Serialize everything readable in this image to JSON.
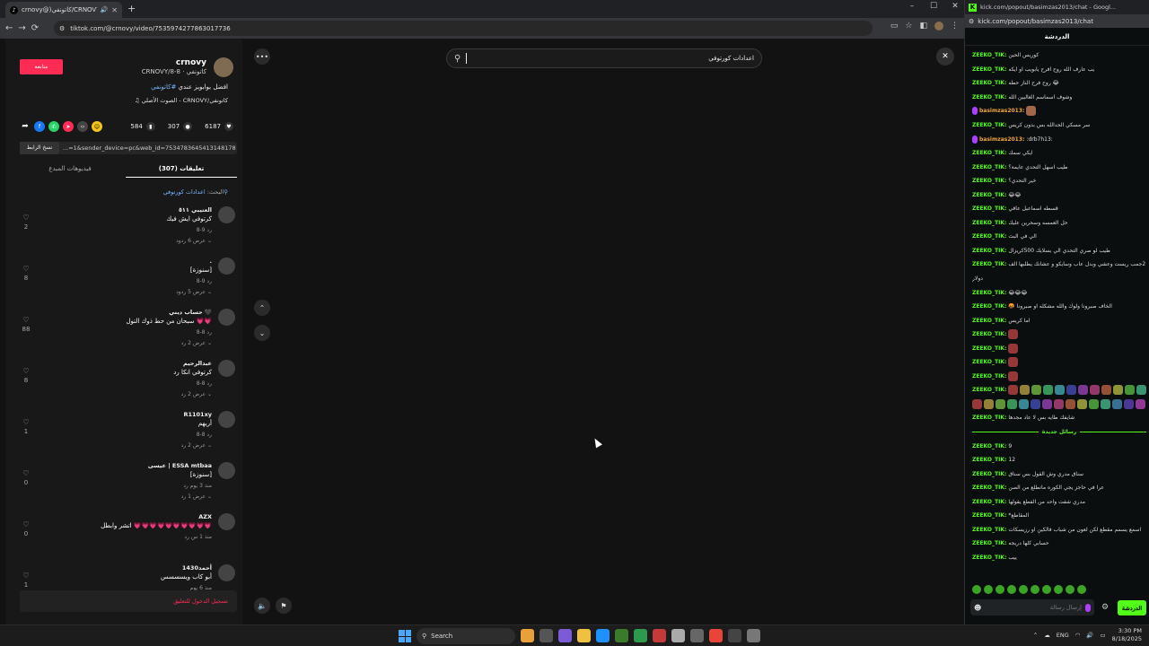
{
  "left_browser": {
    "tab_title": "crnovy@)كاتونفي/CRNOVY",
    "url": "tiktok.com/@crnovy/video/7535974277863017736",
    "new_tab": "+",
    "icons": {
      "back": "arrow-left-icon",
      "forward": "arrow-right-icon",
      "reload": "reload-icon"
    }
  },
  "tiktok": {
    "author": {
      "name": "crnovy",
      "subtitle": "CRNOVY/كاتونفي · 8-8"
    },
    "follow_label": "متابعة",
    "description_text": "افضل بوابويز عندي ",
    "description_tag": "#كاتونفي",
    "music": "♫ الصوت الأصلي - CRNOVY/كاتونفي",
    "stats": {
      "likes": "6187",
      "comments": "307",
      "saves": "584"
    },
    "link": {
      "text": "...=1&sender_device=pc&web_id=7534783645413148178",
      "copy_label": "نسخ الرابط"
    },
    "tabs": {
      "comments": "(307) تعليقات",
      "creator_videos": "فيديوهات المبدع"
    },
    "search_hint_label": "البحث: ",
    "search_hint_value": "اعدادات كورتوفي",
    "comments": [
      {
        "name": "العتيبي ٥١١",
        "text": "كرتوفي ايش فيك",
        "meta": "8-9  رد",
        "replies": "عرض 6 ردود ⌄",
        "likes": "2"
      },
      {
        "name": ".",
        "text": "[سنوزة]",
        "meta": "8-9  رد",
        "replies": "عرض 5 ردود ⌄",
        "likes": "8"
      },
      {
        "name": "حساب ديني 🖤",
        "text": "سبحان من حط ذوك التول 💗💗",
        "meta": "8-8  رد",
        "replies": "عرض 2 رد ⌄",
        "likes": "88"
      },
      {
        "name": "عبدالرحيم",
        "text": "كرتوفي انكا رد",
        "meta": "8-8  رد",
        "replies": "عرض 2 رد ⌄",
        "likes": "8"
      },
      {
        "name": "R1101xy",
        "text": "أريهم",
        "meta": "8-8  رد",
        "replies": "عرض 2 رد ⌄",
        "likes": "1"
      },
      {
        "name": "عيسى | ESSA mtbaa",
        "text": "[سنوزة]",
        "meta": "منذ 3 يوم  رد",
        "replies": "عرض 1 رد ⌄",
        "likes": "0"
      },
      {
        "name": "AZX",
        "text": "اتشر وابطل 💗💗💗💗💗💗💗💗💗💗",
        "meta": "منذ 1 س  رد",
        "replies": "",
        "likes": "0"
      },
      {
        "name": "أحمد1430",
        "text": "أبو كاب ويسسسس",
        "meta": "منذ 6 يوم",
        "replies": "",
        "likes": "1"
      }
    ],
    "login_bar": "تسجيل الدخول للتعليق",
    "search": {
      "value": "اعدادات كورتوفي"
    }
  },
  "right_browser": {
    "title": "kick.com/popout/basimzas2013/chat - Googl...",
    "url": "kick.com/popout/basimzas2013/chat",
    "chat_title": "الدردشة",
    "messages": [
      {
        "user": "ZEEKO_TIK:",
        "text": "كوريس الحين"
      },
      {
        "user": "ZEEKO_TIK:",
        "text": "يب عارف الله روح افرح يابويب او ايكه"
      },
      {
        "user": "ZEEKO_TIK:",
        "text": "روح فرح الناز حطه 😂"
      },
      {
        "user": "ZEEKO_TIK:",
        "text": "وشوف اسماسم الغالبين الله"
      },
      {
        "user": "basimzas2013:",
        "text": "",
        "sub": true
      },
      {
        "user": "ZEEKO_TIK:",
        "text": "سر مسكي الحدالله بس بدون كريس"
      },
      {
        "user": "basimzas2013:",
        "text": ":drb7h13:",
        "sub": true
      },
      {
        "user": "ZEEKO_TIK:",
        "text": "ايكي سمك"
      },
      {
        "user": "ZEEKO_TIK:",
        "text": "طيب اسهل التحدي عايمة؟"
      },
      {
        "user": "ZEEKO_TIK:",
        "text": "خير التحدي؟"
      },
      {
        "user": "ZEEKO_TIK:",
        "text": "😂😂"
      },
      {
        "user": "ZEEKO_TIK:",
        "text": "قسطه اسماعيل عاقي"
      },
      {
        "user": "ZEEKO_TIK:",
        "text": "حل العمسه وسحرين عليك"
      },
      {
        "user": "ZEEKO_TIK:",
        "text": "الي في البث"
      },
      {
        "user": "ZEEKO_TIK:",
        "text": "طيب لو صري التحدي الي بسلايك 500كريزال"
      },
      {
        "user": "ZEEKO_TIK:",
        "text": "سر 2جمب ريست وعشي وبدل عاب وسايكو و عشانك يطلبها الف"
      },
      {
        "user": "",
        "text": "دولار"
      },
      {
        "user": "ZEEKO_TIK:",
        "text": "😂😂😂"
      },
      {
        "user": "ZEEKO_TIK:",
        "text": "🤬 الخاف صبرونا ولوك والله مشكله او صبرونا"
      },
      {
        "user": "ZEEKO_TIK:",
        "text": "اما كريس"
      },
      {
        "user": "ZEEKO_TIK:",
        "text": "",
        "emotes": 1
      },
      {
        "user": "ZEEKO_TIK:",
        "text": "",
        "emotes": 1
      },
      {
        "user": "ZEEKO_TIK:",
        "text": "",
        "emotes": 1
      },
      {
        "user": "ZEEKO_TIK:",
        "text": "",
        "emotes": 1
      },
      {
        "user": "ZEEKO_TIK:",
        "text": "",
        "emotes": 12
      },
      {
        "user": "",
        "text": "",
        "emotes": 15
      },
      {
        "user": "ZEEKO_TIK:",
        "text": "شايفك طايه بس لا عاد مجدها"
      },
      {
        "user": "",
        "text": "رسائل جديدة",
        "divider": true
      },
      {
        "user": "ZEEKO_TIK:",
        "text": "9"
      },
      {
        "user": "ZEEKO_TIK:",
        "text": "12"
      },
      {
        "user": "ZEEKO_TIK:",
        "text": "سناق مدري وش القول بس سناق"
      },
      {
        "user": "ZEEKO_TIK:",
        "text": "عرا في حاجز يجي الكوره ماتطلع من الصن"
      },
      {
        "user": "ZEEKO_TIK:",
        "text": "مدري شفت واحد من الفطع يقولها"
      },
      {
        "user": "ZEEKO_TIK:",
        "text": "*المقاطع"
      },
      {
        "user": "ZEEKO_TIK:",
        "text": "اسمع يسمم مقطع لكن لعون من شباب فالكين او رزيسكات"
      },
      {
        "user": "ZEEKO_TIK:",
        "text": "حسابي كلها دريجه"
      },
      {
        "user": "ZEEKO_TIK:",
        "text": "ييب"
      }
    ],
    "input_placeholder": "إرسال رسالة",
    "chat_button": "الدردشة"
  },
  "taskbar": {
    "search_label": "Search",
    "lang": "ENG",
    "time": "3:30 PM",
    "date": "8/18/2025"
  },
  "colors": {
    "tiktok_red": "#fe2c55",
    "kick_green": "#53fc18",
    "link_blue": "#7cb7ff"
  }
}
